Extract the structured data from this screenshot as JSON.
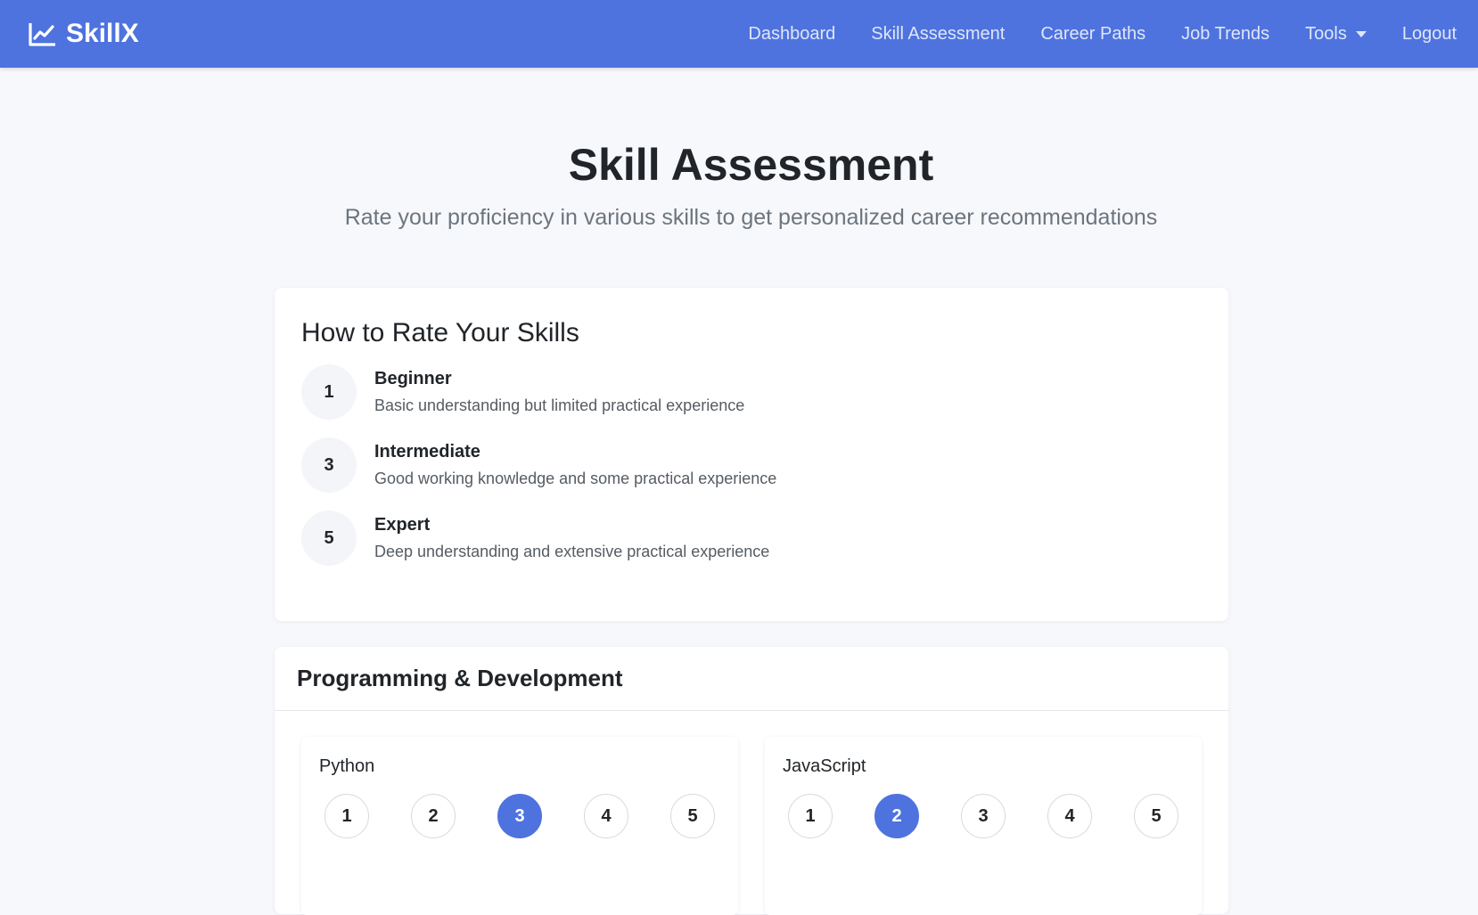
{
  "nav": {
    "brand": "SkillX",
    "links": [
      "Dashboard",
      "Skill Assessment",
      "Career Paths",
      "Job Trends",
      "Tools",
      "Logout"
    ]
  },
  "header": {
    "title": "Skill Assessment",
    "subtitle": "Rate your proficiency in various skills to get personalized career recommendations"
  },
  "how_to_rate": {
    "title": "How to Rate Your Skills",
    "levels": [
      {
        "badge": "1",
        "title": "Beginner",
        "desc": "Basic understanding but limited practical experience"
      },
      {
        "badge": "3",
        "title": "Intermediate",
        "desc": "Good working knowledge and some practical experience"
      },
      {
        "badge": "5",
        "title": "Expert",
        "desc": "Deep understanding and extensive practical experience"
      }
    ]
  },
  "programming": {
    "title": "Programming & Development",
    "skills": [
      {
        "name": "Python",
        "options": [
          "1",
          "2",
          "3",
          "4",
          "5"
        ],
        "selected": "3"
      },
      {
        "name": "JavaScript",
        "options": [
          "1",
          "2",
          "3",
          "4",
          "5"
        ],
        "selected": "2"
      }
    ]
  },
  "colors": {
    "primary": "#4e73df",
    "background": "#f7f8fc"
  }
}
